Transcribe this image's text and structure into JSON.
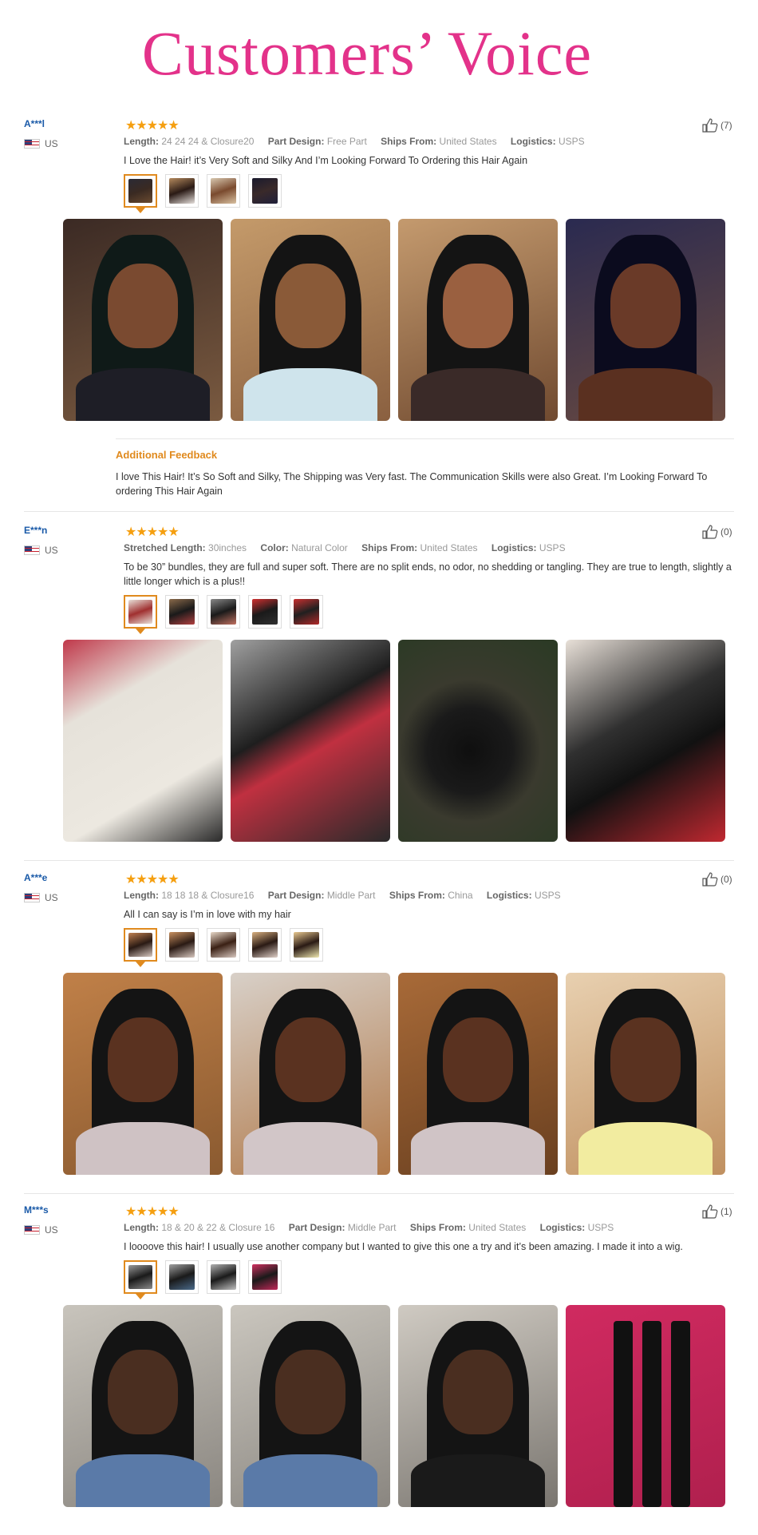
{
  "title": "Customers’ Voice",
  "reviews": [
    {
      "name": "A***l",
      "country": "US",
      "stars": "★★★★★",
      "likes": "(7)",
      "attributes": [
        {
          "key": "Length:",
          "value": "24 24 24 & Closure20"
        },
        {
          "key": "Part Design:",
          "value": "Free Part"
        },
        {
          "key": "Ships From:",
          "value": "United States"
        },
        {
          "key": "Logistics:",
          "value": "USPS"
        }
      ],
      "comment": "I Love the Hair! it’s Very Soft and Silky And I’m Looking Forward To Ordering this Hair Again",
      "additional_title": "Additional Feedback",
      "additional_text": "I love This Hair! It’s So Soft and Silky, The Shipping was Very fast. The Communication Skills were also Great. I’m Looking Forward To ordering This Hair Again"
    },
    {
      "name": "E***n",
      "country": "US",
      "stars": "★★★★★",
      "likes": "(0)",
      "attributes": [
        {
          "key": "Stretched Length:",
          "value": "30inches"
        },
        {
          "key": "Color:",
          "value": "Natural Color"
        },
        {
          "key": "Ships From:",
          "value": "United States"
        },
        {
          "key": "Logistics:",
          "value": "USPS"
        }
      ],
      "comment": "To be 30” bundles, they are full and super soft. There are no split ends, no odor, no shedding or tangling. They are true to length, slightly a little longer which is a plus!!"
    },
    {
      "name": "A***e",
      "country": "US",
      "stars": "★★★★★",
      "likes": "(0)",
      "attributes": [
        {
          "key": "Length:",
          "value": "18 18 18 & Closure16"
        },
        {
          "key": "Part Design:",
          "value": "Middle Part"
        },
        {
          "key": "Ships From:",
          "value": "China"
        },
        {
          "key": "Logistics:",
          "value": "USPS"
        }
      ],
      "comment": "All I can say is I’m in love with my hair"
    },
    {
      "name": "M***s",
      "country": "US",
      "stars": "★★★★★",
      "likes": "(1)",
      "attributes": [
        {
          "key": "Length:",
          "value": "18 & 20 & 22 & Closure 16"
        },
        {
          "key": "Part Design:",
          "value": "Middle Part"
        },
        {
          "key": "Ships From:",
          "value": "United States"
        },
        {
          "key": "Logistics:",
          "value": "USPS"
        }
      ],
      "comment": "I loooove this hair! I usually use another company but I wanted to give this one a try and it’s been amazing. I made it into a wig."
    }
  ],
  "colors": {
    "title": "#e3328a",
    "reviewer": "#1a5aa8",
    "stars": "#f59f10",
    "accent": "#e08a1e"
  }
}
